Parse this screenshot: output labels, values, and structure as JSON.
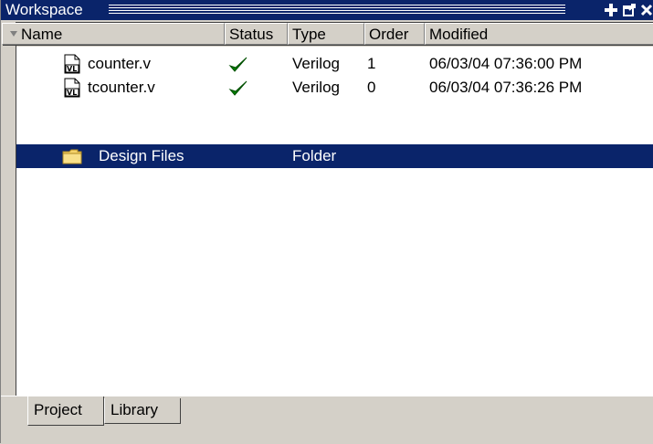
{
  "window": {
    "title": "Workspace",
    "buttons": [
      {
        "name": "dock-icon"
      },
      {
        "name": "undock-icon"
      },
      {
        "name": "close-icon"
      }
    ]
  },
  "columns": {
    "name": "Name",
    "status": "Status",
    "type": "Type",
    "order": "Order",
    "modified": "Modified"
  },
  "rows": [
    {
      "icon": "verilog-file-icon",
      "name": "counter.v",
      "status": "compiled-checkmark-icon",
      "type": "Verilog",
      "order": "1",
      "modified": "06/03/04 07:36:00 PM"
    },
    {
      "icon": "verilog-file-icon",
      "name": "tcounter.v",
      "status": "compiled-checkmark-icon",
      "type": "Verilog",
      "order": "0",
      "modified": "06/03/04 07:36:26 PM"
    },
    {
      "icon": "folder-icon",
      "name": "Design Files",
      "status": "",
      "type": "Folder",
      "order": "",
      "modified": "",
      "selected": true
    }
  ],
  "tabs": [
    {
      "label": "Project",
      "active": true
    },
    {
      "label": "Library",
      "active": false
    }
  ],
  "colors": {
    "titlebar": "#0a246a",
    "selection": "#0a246a",
    "checkmark": "#008000",
    "folder": "#f5d36b"
  }
}
